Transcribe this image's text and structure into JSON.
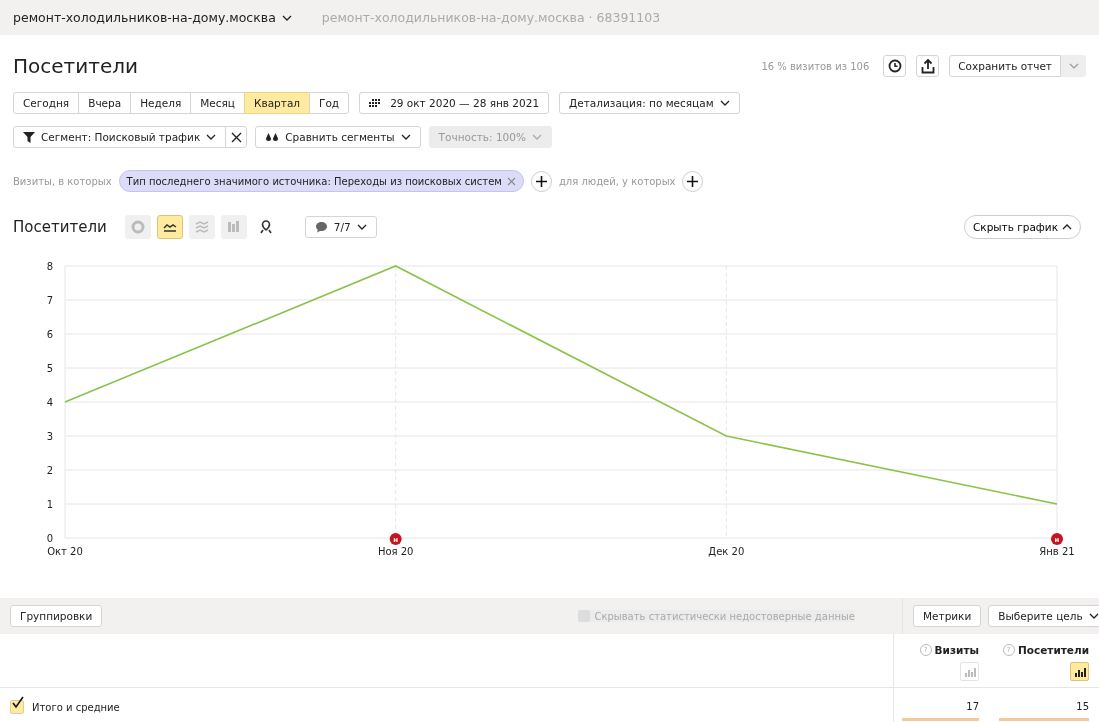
{
  "topbar": {
    "site": "ремонт-холодильников-на-дому.москва",
    "counter": "ремонт-холодильников-на-дому.москва · 68391103"
  },
  "header": {
    "title": "Посетители",
    "sample": "16 % визитов из 106",
    "save_button": "Сохранить отчет"
  },
  "periods": [
    {
      "label": "Сегодня",
      "selected": false
    },
    {
      "label": "Вчера",
      "selected": false
    },
    {
      "label": "Неделя",
      "selected": false
    },
    {
      "label": "Месяц",
      "selected": false
    },
    {
      "label": "Квартал",
      "selected": true
    },
    {
      "label": "Год",
      "selected": false
    }
  ],
  "date_range": "29 окт 2020 — 28 янв 2021",
  "detail": "Детализация: по месяцам",
  "segment": "Сегмент: Поисковый трафик",
  "compare": "Сравнить сегменты",
  "accuracy": {
    "label": "Точность: 100%",
    "disabled": true
  },
  "filter": {
    "prefix": "Визиты, в которых",
    "chip": "Тип последнего значимого источника: Переходы из поисковых систем",
    "people": "для людей, у которых"
  },
  "chart_header": {
    "title": "Посетители",
    "notes": "7/7",
    "hide": "Скрыть график",
    "chart_types": [
      {
        "kind": "pie",
        "selected": false,
        "disabled": true
      },
      {
        "kind": "line",
        "selected": true,
        "disabled": false
      },
      {
        "kind": "area",
        "selected": false,
        "disabled": true
      },
      {
        "kind": "bar",
        "selected": false,
        "disabled": true
      },
      {
        "kind": "map",
        "selected": false,
        "disabled": false
      }
    ]
  },
  "chart": {
    "chart_data": {
      "type": "line",
      "categories": [
        "Окт 20",
        "Ноя 20",
        "Дек 20",
        "Янв 21"
      ],
      "series": [
        {
          "color": "#8bc34a",
          "values": [
            4,
            8,
            3,
            1
          ]
        }
      ],
      "ylim": [
        0,
        8
      ],
      "yticks": [
        0,
        1,
        2,
        3,
        4,
        5,
        6,
        7,
        8
      ],
      "grid": true,
      "annotations": [
        {
          "x": "Ноя 20",
          "text": "н"
        },
        {
          "x": "Янв 21",
          "text": "н"
        }
      ]
    }
  },
  "toolbar": {
    "groupings": "Группировки",
    "hide_unreliable": {
      "label": "Скрывать статистически недостоверные данные",
      "checked": false,
      "disabled": true
    },
    "metrics": "Метрики",
    "goal": "Выберите цель"
  },
  "table": {
    "columns": [
      {
        "hint": "?",
        "label": "Визиты",
        "selected": false
      },
      {
        "hint": "?",
        "label": "Посетители",
        "selected": true
      }
    ],
    "rows": [
      {
        "label": "Итого и средние",
        "checked": true,
        "cells": [
          {
            "value": "17",
            "level": 1
          },
          {
            "value": "15",
            "level": 1
          }
        ]
      }
    ]
  }
}
